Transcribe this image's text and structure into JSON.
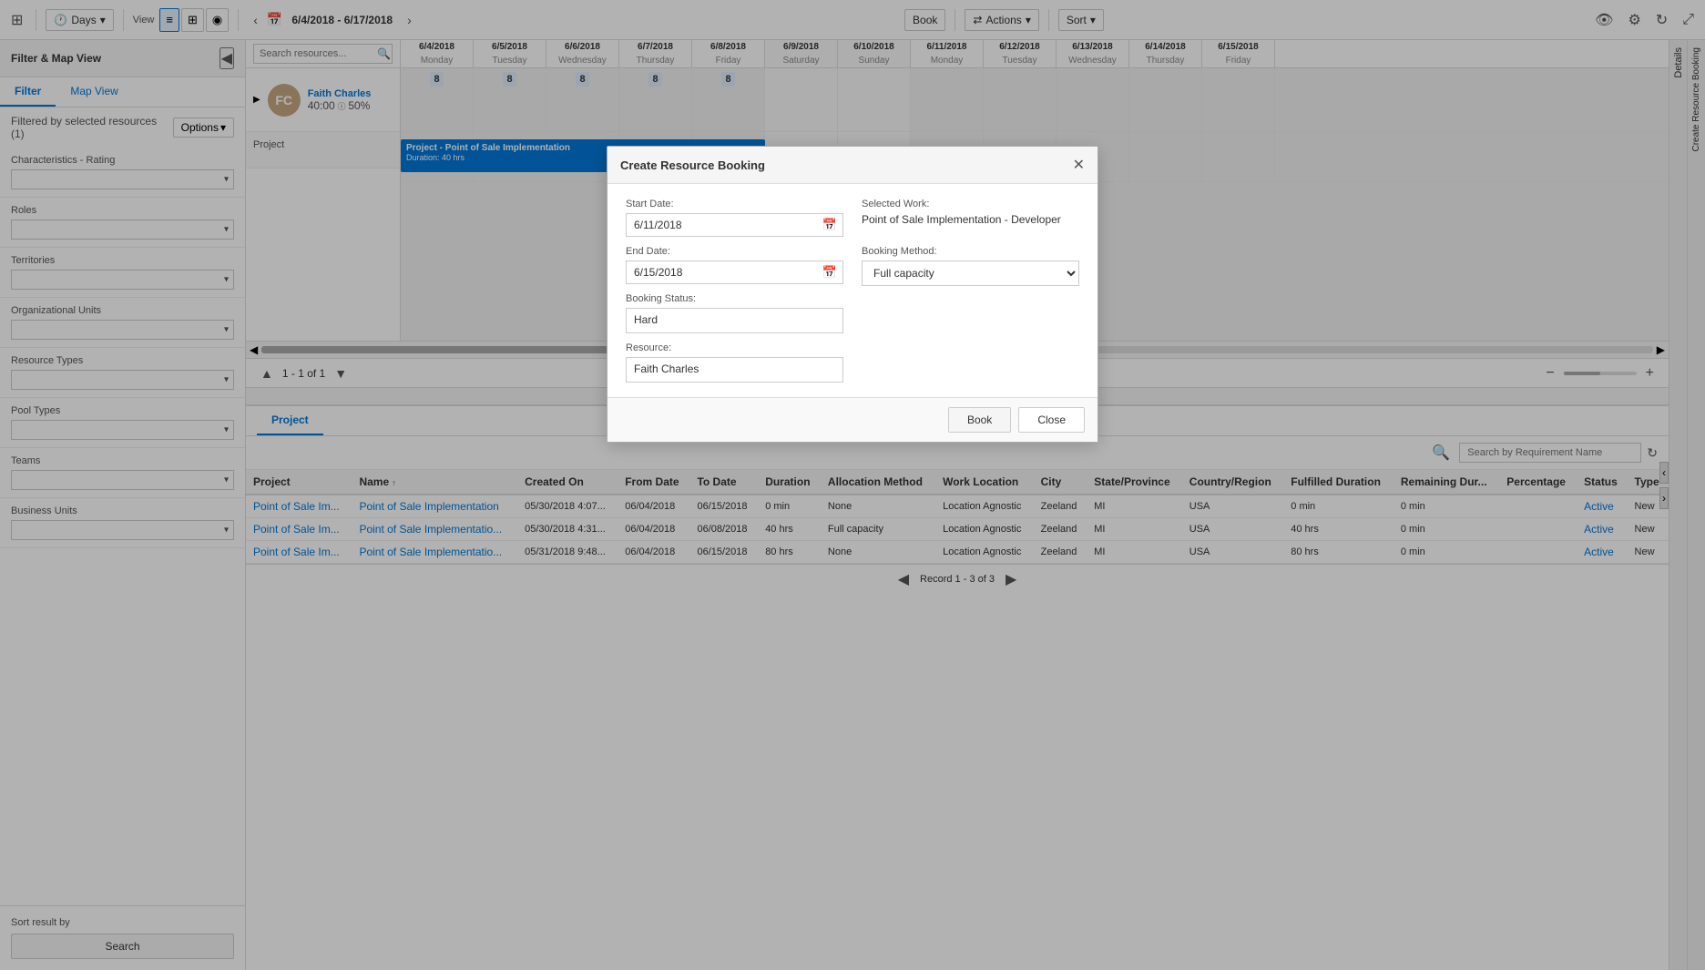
{
  "toolbar": {
    "days_label": "Days",
    "view_label": "View",
    "date_range": "6/4/2018 - 6/17/2018",
    "book_label": "Book",
    "actions_label": "Actions",
    "sort_label": "Sort"
  },
  "sidebar": {
    "title": "Filter & Map View",
    "tabs": [
      "Filter",
      "Map View"
    ],
    "filter_info": "Filtered by selected resources (1)",
    "options_label": "Options",
    "sections": [
      {
        "label": "Characteristics - Rating",
        "value": ""
      },
      {
        "label": "Roles",
        "value": ""
      },
      {
        "label": "Territories",
        "value": ""
      },
      {
        "label": "Organizational Units",
        "value": ""
      },
      {
        "label": "Resource Types",
        "value": ""
      },
      {
        "label": "Pool Types",
        "value": ""
      },
      {
        "label": "Teams",
        "value": ""
      },
      {
        "label": "Business Units",
        "value": ""
      }
    ],
    "sort_result_label": "Sort result by",
    "search_label": "Search"
  },
  "schedule": {
    "search_placeholder": "Search resources...",
    "dates": [
      {
        "date": "6/4/2018",
        "day": "Monday",
        "num": "6/4"
      },
      {
        "date": "6/5/2018",
        "day": "Tuesday",
        "num": "6/5"
      },
      {
        "date": "6/6/2018",
        "day": "Wednesday",
        "num": "6/6"
      },
      {
        "date": "6/7/2018",
        "day": "Thursday",
        "num": "6/7"
      },
      {
        "date": "6/8/2018",
        "day": "Friday",
        "num": "6/8"
      },
      {
        "date": "6/9/2018",
        "day": "Saturday",
        "num": "6/9",
        "weekend": true
      },
      {
        "date": "6/10/2018",
        "day": "Sunday",
        "num": "6/10",
        "weekend": true
      },
      {
        "date": "6/11/2018",
        "day": "Monday",
        "num": "6/11"
      },
      {
        "date": "6/12/2018",
        "day": "Tuesday",
        "num": "6/12"
      },
      {
        "date": "6/13/2018",
        "day": "Wednesday",
        "num": "6/13"
      },
      {
        "date": "6/14/2018",
        "day": "Thursday",
        "num": "6/14"
      },
      {
        "date": "6/15/2018",
        "day": "Friday",
        "num": "6/15"
      }
    ],
    "resource": {
      "name": "Faith Charles",
      "hours": "40:00",
      "percentage": "50%",
      "type": "Project",
      "avatar_initials": "FC"
    },
    "booking": {
      "label": "Project - Point of Sale Implementation",
      "duration": "Duration: 40 hrs"
    },
    "hours_per_day": [
      "8",
      "8",
      "8",
      "8",
      "8"
    ]
  },
  "pagination": {
    "info": "1 - 1 of 1"
  },
  "modal": {
    "title": "Create Resource Booking",
    "start_date_label": "Start Date:",
    "start_date_value": "6/11/2018",
    "end_date_label": "End Date:",
    "end_date_value": "6/15/2018",
    "booking_status_label": "Booking Status:",
    "booking_status_value": "Hard",
    "resource_label": "Resource:",
    "resource_value": "Faith Charles",
    "selected_work_label": "Selected Work:",
    "selected_work_value": "Point of Sale Implementation - Developer",
    "booking_method_label": "Booking Method:",
    "booking_method_value": "Full capacity",
    "book_btn": "Book",
    "close_btn": "Close"
  },
  "bottom_grid": {
    "tab": "Project",
    "search_placeholder": "Search by Requirement Name",
    "columns": [
      "Project",
      "Name",
      "Created On",
      "From Date",
      "To Date",
      "Duration",
      "Allocation Method",
      "Work Location",
      "City",
      "State/Province",
      "Country/Region",
      "Fulfilled Duration",
      "Remaining Dur...",
      "Percentage",
      "Status",
      "Type"
    ],
    "rows": [
      {
        "project": "Point of Sale Im...",
        "name": "Point of Sale Implementation",
        "created_on": "05/30/2018 4:07...",
        "from_date": "06/04/2018",
        "to_date": "06/15/2018",
        "duration": "0 min",
        "allocation": "None",
        "work_location": "Location Agnostic",
        "city": "Zeeland",
        "state": "MI",
        "country": "USA",
        "fulfilled": "0 min",
        "remaining": "0 min",
        "percentage": "",
        "status": "Active",
        "type": "New"
      },
      {
        "project": "Point of Sale Im...",
        "name": "Point of Sale Implementatio...",
        "created_on": "05/30/2018 4:31...",
        "from_date": "06/04/2018",
        "to_date": "06/08/2018",
        "duration": "40 hrs",
        "allocation": "Full capacity",
        "work_location": "Location Agnostic",
        "city": "Zeeland",
        "state": "MI",
        "country": "USA",
        "fulfilled": "40 hrs",
        "remaining": "0 min",
        "percentage": "",
        "status": "Active",
        "type": "New"
      },
      {
        "project": "Point of Sale Im...",
        "name": "Point of Sale Implementatio...",
        "created_on": "05/31/2018 9:48...",
        "from_date": "06/04/2018",
        "to_date": "06/15/2018",
        "duration": "80 hrs",
        "allocation": "None",
        "work_location": "Location Agnostic",
        "city": "Zeeland",
        "state": "MI",
        "country": "USA",
        "fulfilled": "80 hrs",
        "remaining": "0 min",
        "percentage": "",
        "status": "Active",
        "type": "New"
      }
    ],
    "record_nav": "Record 1 - 3 of 3"
  }
}
